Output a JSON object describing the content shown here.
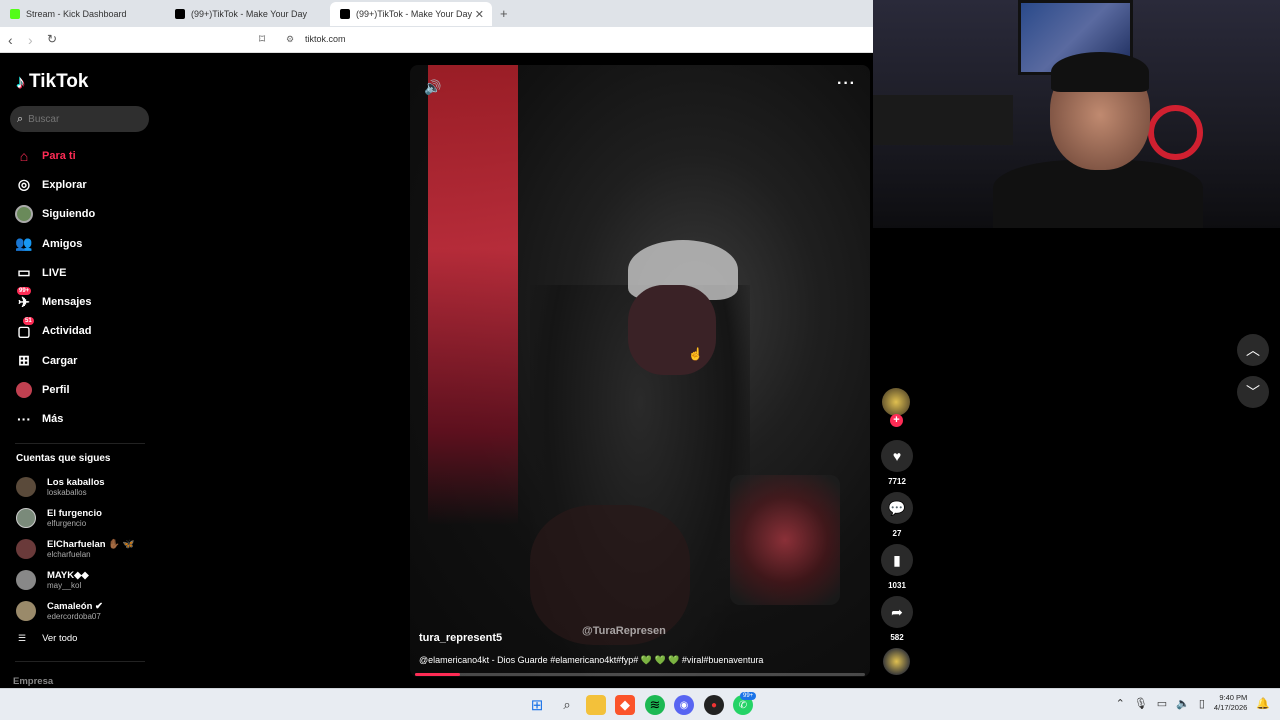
{
  "browser": {
    "tabs": [
      {
        "label": "Stream - Kick Dashboard",
        "color": "#53fc18",
        "active": false
      },
      {
        "label": "(99+)TikTok - Make Your Day",
        "color": "#000000",
        "active": false
      },
      {
        "label": "(99+)TikTok - Make Your Day",
        "color": "#000000",
        "active": true
      }
    ],
    "url": "tiktok.com"
  },
  "sidebar": {
    "logo": "TikTok",
    "search_placeholder": "Buscar",
    "nav": [
      {
        "label": "Para ti",
        "icon": "home-icon",
        "active": true
      },
      {
        "label": "Explorar",
        "icon": "compass-icon"
      },
      {
        "label": "Siguiendo",
        "icon": "avatar-icon"
      },
      {
        "label": "Amigos",
        "icon": "friends-icon"
      },
      {
        "label": "LIVE",
        "icon": "live-icon"
      },
      {
        "label": "Mensajes",
        "icon": "messages-icon",
        "badge": "99+"
      },
      {
        "label": "Actividad",
        "icon": "activity-icon",
        "badge": "51"
      },
      {
        "label": "Cargar",
        "icon": "upload-icon"
      },
      {
        "label": "Perfil",
        "icon": "profile-icon"
      },
      {
        "label": "Más",
        "icon": "more-icon"
      }
    ],
    "following_title": "Cuentas que sigues",
    "accounts": [
      {
        "name": "Los kaballos",
        "handle": "loskaballos"
      },
      {
        "name": "El furgencio",
        "handle": "elfurgencio"
      },
      {
        "name": "ElCharfuelan ✋🏾 🦋",
        "handle": "elcharfuelan"
      },
      {
        "name": "MAYK◆◆",
        "handle": "may__kol"
      },
      {
        "name": "Camaleón ✔",
        "handle": "edercordoba07"
      }
    ],
    "see_all": "Ver todo",
    "footer": "Empresa"
  },
  "video": {
    "author": "tura_represent5",
    "caption": "@elamericano4kt - Dios Guarde #elamericano4kt#fyp# 💚 💚 💚 #viral#buenaventura",
    "watermark": "@TuraRepresen",
    "progress": 0.1
  },
  "actions": {
    "likes": "7712",
    "comments": "27",
    "saves": "1031",
    "shares": "582"
  },
  "taskbar": {
    "time": "9:40 PM",
    "date": "4/17/2026",
    "badge": "99+"
  }
}
